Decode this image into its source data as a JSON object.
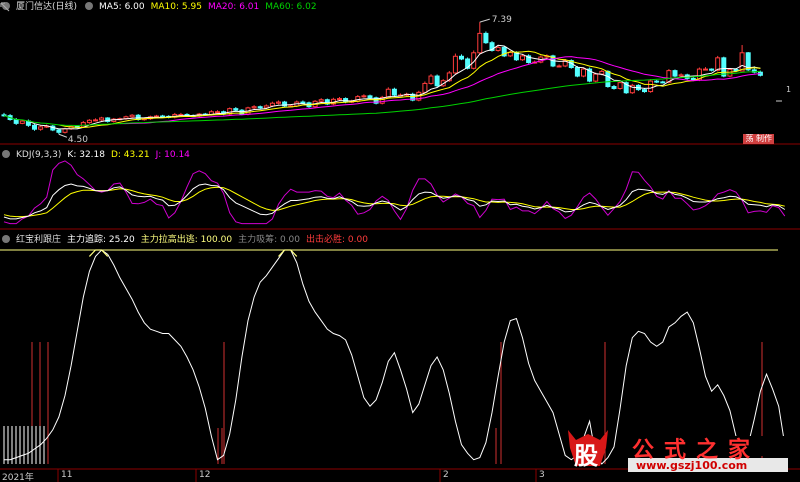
{
  "main_header": {
    "title": "厦门信达(日线)",
    "ma5": "MA5: 6.00",
    "ma10": "MA10: 5.95",
    "ma20": "MA20: 6.01",
    "ma60": "MA60: 6.02"
  },
  "price_labels": {
    "high": "7.39",
    "low": "4.50",
    "right_mark": "1"
  },
  "badge_text": "荡 制作",
  "kdj_header": {
    "title": "KDJ(9,3,3)",
    "k": "K: 32.18",
    "d": "D: 43.21",
    "j": "J: 10.14"
  },
  "ind_header": {
    "title": "红宝利跟庄",
    "a": "主力追踪: 25.20",
    "b": "主力拉高出逃: 100.00",
    "c": "主力吸筹: 0.00",
    "d": "出击必胜: 0.00"
  },
  "x_axis": {
    "year": "2021年",
    "ticks": [
      "11",
      "12",
      "2",
      "3"
    ]
  },
  "watermark": {
    "left": "股",
    "right": "公式之家",
    "url": "www.gszj100.com"
  },
  "colors": {
    "bg": "#000000",
    "up": "#ff3c3c",
    "down": "#54ffff",
    "ma5": "#ffffff",
    "ma10": "#ffff00",
    "ma20": "#ff00ff",
    "ma60": "#00d200",
    "k": "#ffffff",
    "d": "#ffff00",
    "j": "#d000d0",
    "track": "#ffffff",
    "cap": "#ffff80",
    "bar": "#d03030"
  },
  "chart_data": [
    {
      "type": "candlestick",
      "title": "厦门信达(日线)",
      "price_range": [
        4.3,
        7.6
      ],
      "annotations": {
        "max": 7.39,
        "min": 4.5
      },
      "close": [
        4.98,
        4.88,
        4.78,
        4.84,
        4.73,
        4.63,
        4.69,
        4.71,
        4.61,
        4.55,
        4.64,
        4.7,
        4.69,
        4.8,
        4.86,
        4.87,
        4.92,
        4.83,
        4.89,
        4.9,
        4.95,
        4.99,
        4.88,
        4.9,
        4.95,
        4.97,
        4.96,
        4.94,
        5.01,
        5.01,
        4.98,
        4.97,
        5.02,
        5.01,
        5.08,
        5.08,
        5.02,
        5.16,
        5.12,
        5.02,
        5.18,
        5.21,
        5.18,
        5.23,
        5.3,
        5.33,
        5.23,
        5.23,
        5.33,
        5.31,
        5.21,
        5.35,
        5.39,
        5.28,
        5.4,
        5.42,
        5.33,
        5.35,
        5.47,
        5.49,
        5.44,
        5.3,
        5.45,
        5.66,
        5.51,
        5.51,
        5.53,
        5.38,
        5.58,
        5.81,
        6.0,
        5.75,
        5.88,
        6.08,
        6.51,
        6.44,
        6.2,
        6.6,
        7.1,
        6.86,
        6.66,
        6.74,
        6.52,
        6.61,
        6.42,
        6.52,
        6.35,
        6.36,
        6.49,
        6.52,
        6.26,
        6.26,
        6.4,
        6.22,
        6.0,
        6.18,
        5.87,
        6.05,
        6.12,
        5.73,
        5.68,
        5.83,
        5.57,
        5.76,
        5.65,
        5.6,
        5.87,
        5.85,
        5.84,
        6.14,
        6.0,
        6.03,
        5.94,
        5.9,
        6.18,
        6.18,
        6.15,
        6.47,
        6.0,
        6.17,
        6.13,
        6.6,
        6.16,
        6.1,
        6.02
      ],
      "open": [
        5.0,
        4.98,
        4.88,
        4.78,
        4.84,
        4.73,
        4.63,
        4.69,
        4.71,
        4.61,
        4.55,
        4.64,
        4.7,
        4.69,
        4.8,
        4.86,
        4.87,
        4.92,
        4.83,
        4.89,
        4.9,
        4.95,
        4.99,
        4.88,
        4.9,
        4.95,
        4.97,
        4.96,
        4.94,
        5.01,
        5.01,
        4.98,
        4.97,
        5.02,
        5.01,
        5.08,
        5.08,
        5.02,
        5.16,
        5.12,
        5.02,
        5.18,
        5.21,
        5.18,
        5.23,
        5.3,
        5.33,
        5.23,
        5.23,
        5.33,
        5.31,
        5.21,
        5.35,
        5.39,
        5.28,
        5.4,
        5.42,
        5.33,
        5.35,
        5.47,
        5.49,
        5.44,
        5.3,
        5.45,
        5.66,
        5.51,
        5.51,
        5.53,
        5.38,
        5.58,
        5.81,
        6.0,
        5.75,
        5.88,
        6.08,
        6.51,
        6.44,
        6.2,
        6.6,
        7.1,
        6.86,
        6.66,
        6.74,
        6.52,
        6.61,
        6.42,
        6.52,
        6.35,
        6.36,
        6.49,
        6.52,
        6.26,
        6.26,
        6.4,
        6.22,
        6.0,
        6.18,
        5.87,
        6.05,
        6.12,
        5.73,
        5.68,
        5.83,
        5.57,
        5.76,
        5.65,
        5.6,
        5.87,
        5.85,
        5.84,
        6.14,
        6.0,
        6.03,
        5.94,
        5.9,
        6.18,
        6.18,
        6.15,
        6.47,
        6.0,
        6.17,
        6.13,
        6.6,
        6.16,
        6.1
      ],
      "high": [
        5.05,
        5.02,
        4.92,
        4.88,
        4.88,
        4.77,
        4.72,
        4.75,
        4.74,
        4.63,
        4.67,
        4.73,
        4.73,
        4.84,
        4.89,
        4.91,
        4.95,
        4.94,
        4.92,
        4.93,
        4.98,
        5.02,
        5.02,
        4.93,
        4.98,
        5.0,
        5.0,
        4.99,
        5.05,
        5.05,
        5.04,
        5.01,
        5.05,
        5.05,
        5.12,
        5.12,
        5.11,
        5.19,
        5.2,
        5.15,
        5.21,
        5.25,
        5.24,
        5.27,
        5.34,
        5.37,
        5.36,
        5.27,
        5.37,
        5.37,
        5.34,
        5.38,
        5.43,
        5.42,
        5.44,
        5.46,
        5.45,
        5.39,
        5.51,
        5.53,
        5.52,
        5.47,
        5.49,
        5.71,
        5.7,
        5.55,
        5.57,
        5.57,
        5.62,
        5.86,
        6.05,
        6.04,
        5.92,
        6.13,
        6.58,
        6.56,
        6.48,
        6.66,
        7.39,
        7.15,
        6.9,
        6.79,
        6.78,
        6.65,
        6.64,
        6.56,
        6.56,
        6.4,
        6.53,
        6.56,
        6.55,
        6.3,
        6.44,
        6.43,
        6.26,
        6.22,
        6.22,
        6.09,
        6.16,
        6.15,
        5.77,
        5.87,
        5.86,
        5.8,
        5.79,
        5.68,
        5.92,
        5.9,
        5.88,
        6.18,
        6.17,
        6.07,
        6.06,
        5.97,
        6.22,
        6.23,
        6.2,
        6.52,
        6.5,
        6.21,
        6.2,
        6.8,
        6.62,
        6.25,
        6.14
      ],
      "low": [
        4.95,
        4.85,
        4.74,
        4.76,
        4.69,
        4.59,
        4.59,
        4.66,
        4.58,
        4.5,
        4.52,
        4.61,
        4.65,
        4.66,
        4.77,
        4.83,
        4.84,
        4.8,
        4.8,
        4.86,
        4.87,
        4.92,
        4.85,
        4.85,
        4.87,
        4.92,
        4.93,
        4.91,
        4.91,
        4.98,
        4.95,
        4.94,
        4.94,
        4.98,
        4.98,
        5.05,
        4.99,
        4.99,
        5.09,
        4.99,
        4.99,
        5.15,
        5.15,
        5.15,
        5.2,
        5.27,
        5.2,
        5.2,
        5.2,
        5.28,
        5.18,
        5.18,
        5.32,
        5.25,
        5.25,
        5.37,
        5.3,
        5.3,
        5.32,
        5.44,
        5.41,
        5.27,
        5.27,
        5.42,
        5.48,
        5.48,
        5.48,
        5.35,
        5.35,
        5.55,
        5.78,
        5.72,
        5.72,
        5.85,
        6.05,
        6.41,
        6.17,
        6.17,
        6.57,
        6.83,
        6.63,
        6.63,
        6.49,
        6.49,
        6.39,
        6.39,
        6.32,
        6.32,
        6.33,
        6.46,
        6.23,
        6.23,
        6.23,
        6.19,
        5.97,
        5.97,
        5.84,
        5.84,
        6.02,
        5.7,
        5.65,
        5.65,
        5.54,
        5.54,
        5.62,
        5.57,
        5.57,
        5.82,
        5.81,
        5.81,
        5.97,
        5.97,
        5.91,
        5.87,
        5.87,
        6.15,
        6.12,
        6.12,
        5.97,
        5.97,
        6.1,
        6.13,
        6.13,
        6.07,
        5.99
      ]
    },
    {
      "type": "line",
      "title": "KDJ(9,3,3)",
      "series": [
        {
          "name": "K",
          "values": [
            14,
            10,
            10,
            13,
            16,
            23,
            27,
            34,
            60,
            72,
            81,
            84,
            80,
            79,
            75,
            70,
            69,
            70,
            76,
            78,
            71,
            61,
            58,
            57,
            58,
            53,
            50,
            38,
            39,
            47,
            60,
            74,
            82,
            84,
            81,
            80,
            72,
            55,
            44,
            38,
            32,
            26,
            20,
            19,
            22,
            33,
            42,
            49,
            49,
            51,
            53,
            56,
            57,
            54,
            53,
            57,
            52,
            47,
            38,
            37,
            38,
            44,
            48,
            45,
            37,
            29,
            36,
            51,
            63,
            67,
            66,
            59,
            54,
            56,
            59,
            57,
            51,
            48,
            37,
            40,
            48,
            47,
            48,
            40,
            41,
            37,
            35,
            31,
            34,
            39,
            34,
            31,
            25,
            26,
            32,
            40,
            45,
            42,
            36,
            30,
            34,
            39,
            51,
            68,
            73,
            72,
            70,
            64,
            62,
            68,
            62,
            60,
            54,
            47,
            46,
            46,
            48,
            53,
            55,
            58,
            57,
            51,
            41,
            40,
            39,
            36,
            40,
            38,
            30
          ]
        },
        {
          "name": "D",
          "values": [
            19,
            16,
            15,
            15,
            16,
            18,
            20,
            23,
            33,
            44,
            55,
            64,
            68,
            71,
            71,
            70,
            70,
            70,
            72,
            74,
            73,
            70,
            66,
            63,
            61,
            59,
            56,
            51,
            47,
            47,
            51,
            58,
            67,
            73,
            76,
            77,
            76,
            71,
            64,
            57,
            50,
            43,
            36,
            31,
            28,
            29,
            33,
            37,
            40,
            43,
            46,
            49,
            51,
            52,
            52,
            53,
            53,
            51,
            47,
            44,
            42,
            42,
            43,
            43,
            42,
            39,
            38,
            41,
            47,
            53,
            57,
            58,
            58,
            57,
            57,
            57,
            55,
            53,
            49,
            46,
            46,
            45,
            46,
            45,
            44,
            42,
            39,
            36,
            35,
            35,
            35,
            34,
            32,
            30,
            30,
            32,
            35,
            37,
            37,
            36,
            35,
            35,
            40,
            47,
            55,
            62,
            66,
            67,
            67,
            67,
            66,
            63,
            60,
            56,
            53,
            50,
            48,
            48,
            49,
            51,
            52,
            52,
            50,
            47,
            45,
            42,
            41,
            40,
            37
          ]
        },
        {
          "name": "J",
          "values": [
            4,
            0,
            0,
            10,
            16,
            33,
            42,
            56,
            114,
            128,
            133,
            124,
            104,
            95,
            83,
            70,
            67,
            70,
            84,
            86,
            67,
            43,
            42,
            45,
            52,
            41,
            38,
            12,
            23,
            47,
            78,
            106,
            112,
            106,
            91,
            86,
            64,
            23,
            4,
            0,
            0,
            0,
            0,
            0,
            10,
            41,
            60,
            73,
            67,
            67,
            67,
            70,
            69,
            58,
            55,
            65,
            50,
            39,
            20,
            23,
            30,
            48,
            58,
            49,
            27,
            9,
            32,
            71,
            95,
            95,
            84,
            61,
            46,
            54,
            63,
            57,
            43,
            38,
            13,
            28,
            52,
            51,
            52,
            30,
            35,
            27,
            27,
            21,
            32,
            47,
            32,
            25,
            11,
            18,
            36,
            56,
            65,
            52,
            34,
            18,
            32,
            47,
            73,
            110,
            109,
            92,
            78,
            58,
            52,
            70,
            54,
            54,
            42,
            29,
            32,
            38,
            48,
            63,
            67,
            72,
            67,
            49,
            23,
            26,
            27,
            24,
            38,
            34,
            16
          ]
        }
      ]
    },
    {
      "type": "line",
      "title": "红宝利跟庄",
      "series": [
        {
          "name": "主力追踪",
          "values": [
            2,
            2,
            3,
            4,
            5,
            7,
            9,
            12,
            16,
            22,
            32,
            46,
            62,
            78,
            90,
            97,
            100,
            98,
            93,
            87,
            82,
            77,
            71,
            66,
            63,
            62,
            61,
            61,
            58,
            55,
            50,
            44,
            36,
            26,
            13,
            2,
            4,
            14,
            30,
            50,
            67,
            78,
            85,
            88,
            92,
            96,
            100,
            100,
            94,
            84,
            76,
            71,
            67,
            63,
            61,
            60,
            58,
            51,
            41,
            31,
            27,
            30,
            38,
            48,
            52,
            44,
            35,
            24,
            28,
            37,
            46,
            50,
            44,
            33,
            20,
            9,
            5,
            2,
            3,
            10,
            24,
            41,
            57,
            67,
            68,
            59,
            47,
            39,
            34,
            29,
            24,
            14,
            4,
            2,
            4,
            12,
            20,
            4,
            0,
            3,
            8,
            26,
            46,
            59,
            62,
            61,
            57,
            55,
            57,
            64,
            66,
            69,
            71,
            66,
            54,
            41,
            34,
            37,
            32,
            25,
            13,
            8,
            9,
            21,
            34,
            42,
            35,
            27,
            9
          ]
        },
        {
          "name": "主力拉高出逃",
          "values": [
            0,
            0,
            0,
            0,
            0,
            0,
            0,
            0,
            0,
            0,
            0,
            0,
            0,
            0,
            0,
            100,
            100,
            0,
            0,
            0,
            0,
            0,
            0,
            0,
            0,
            0,
            0,
            0,
            0,
            0,
            0,
            0,
            0,
            0,
            0,
            0,
            0,
            0,
            0,
            0,
            0,
            0,
            0,
            0,
            0,
            0,
            100,
            100,
            0,
            0,
            0,
            0,
            0,
            0,
            0,
            0,
            0,
            0,
            0,
            0,
            0,
            0,
            0,
            0,
            0,
            0,
            0,
            0,
            0,
            0,
            0,
            0,
            0,
            0,
            0,
            0,
            0,
            0,
            0,
            0,
            0,
            0,
            0,
            0,
            0,
            0,
            0,
            0,
            0,
            0,
            0,
            0,
            0,
            0,
            0,
            0,
            0,
            0,
            0,
            0,
            0,
            0,
            0,
            0,
            0,
            0,
            0,
            0,
            0,
            0,
            0,
            0,
            0,
            0,
            0,
            0,
            0,
            0,
            0,
            0,
            0,
            0,
            0,
            0,
            0,
            0,
            0,
            0,
            0
          ]
        }
      ]
    }
  ]
}
